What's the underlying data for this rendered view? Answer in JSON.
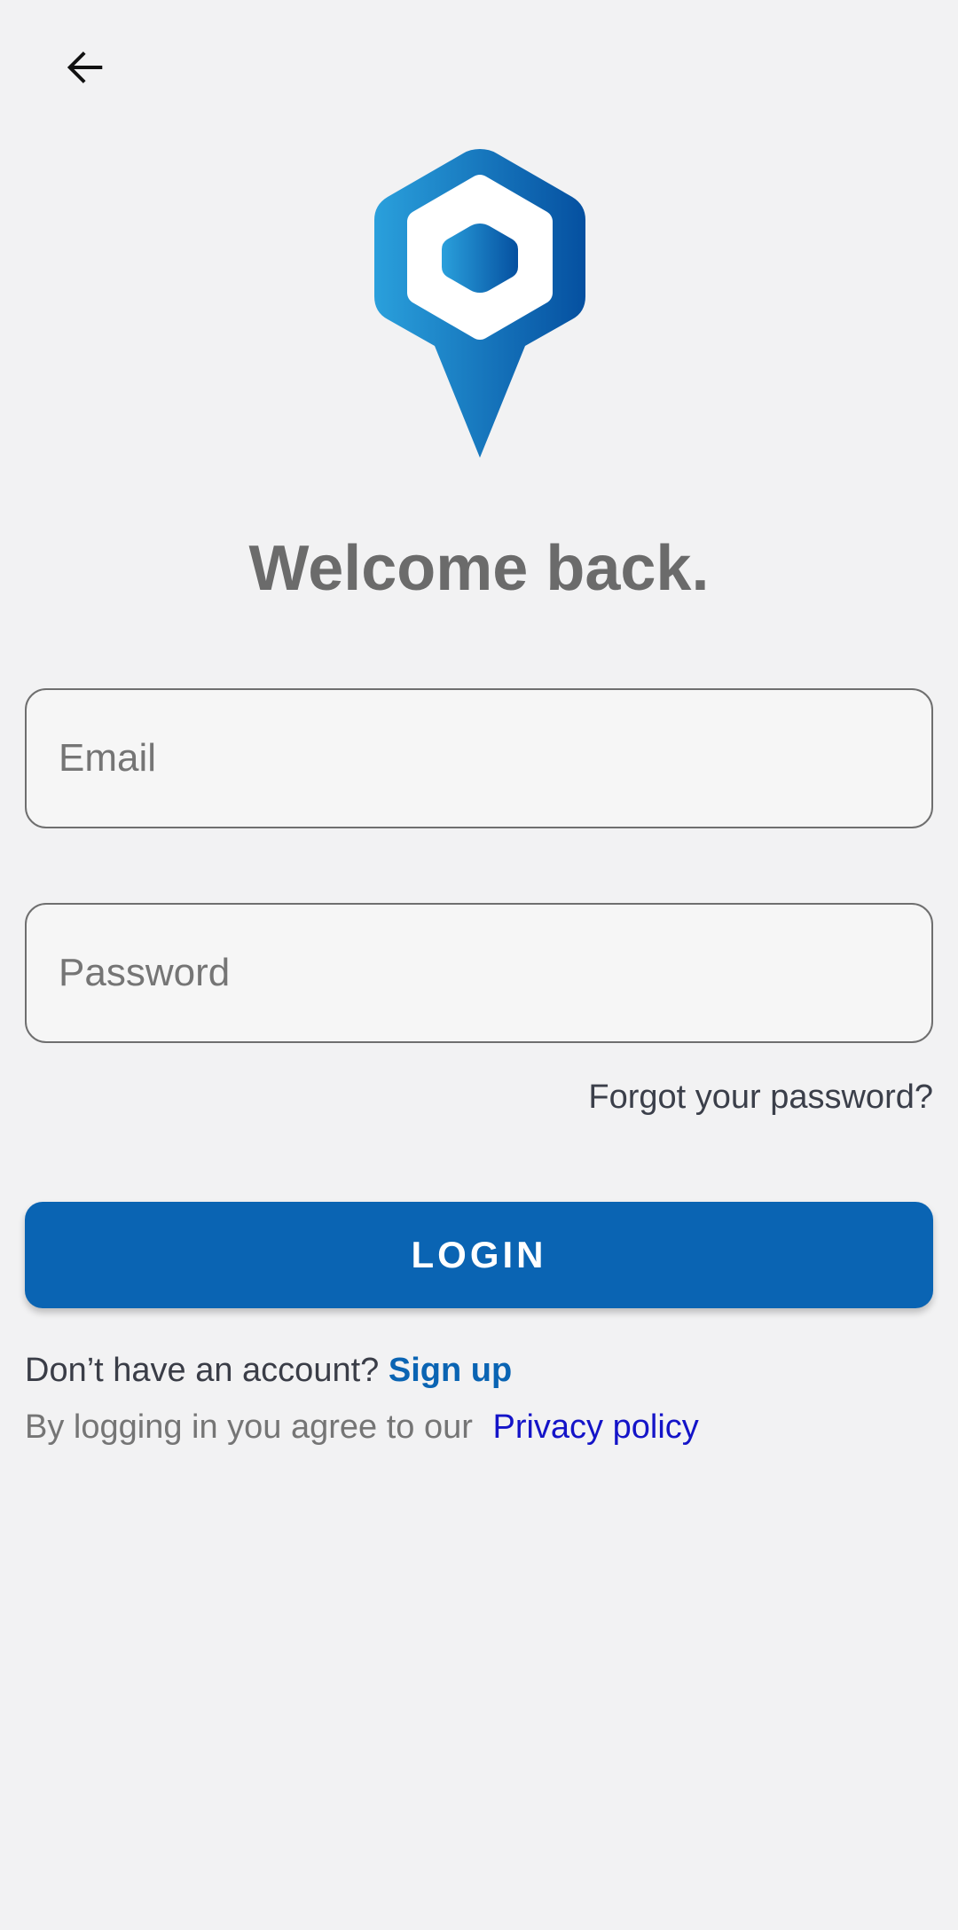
{
  "header": {
    "back_icon": "arrow-left-icon"
  },
  "branding": {
    "logo_icon": "hexagon-location-pin-icon",
    "gradient_start": "#2aa0dc",
    "gradient_end": "#0550a0"
  },
  "title": "Welcome back.",
  "form": {
    "email_placeholder": "Email",
    "email_value": "",
    "password_placeholder": "Password",
    "password_value": "",
    "forgot_label": "Forgot your password?",
    "login_label": "LOGIN"
  },
  "footer": {
    "signup_prompt": "Don’t have an account?",
    "signup_link": "Sign up",
    "privacy_prompt": "By logging in you agree to our",
    "privacy_link": "Privacy policy"
  },
  "colors": {
    "background": "#f2f2f3",
    "primary": "#0a64b3",
    "title": "#6b6b6b",
    "link": "#1414c8"
  }
}
